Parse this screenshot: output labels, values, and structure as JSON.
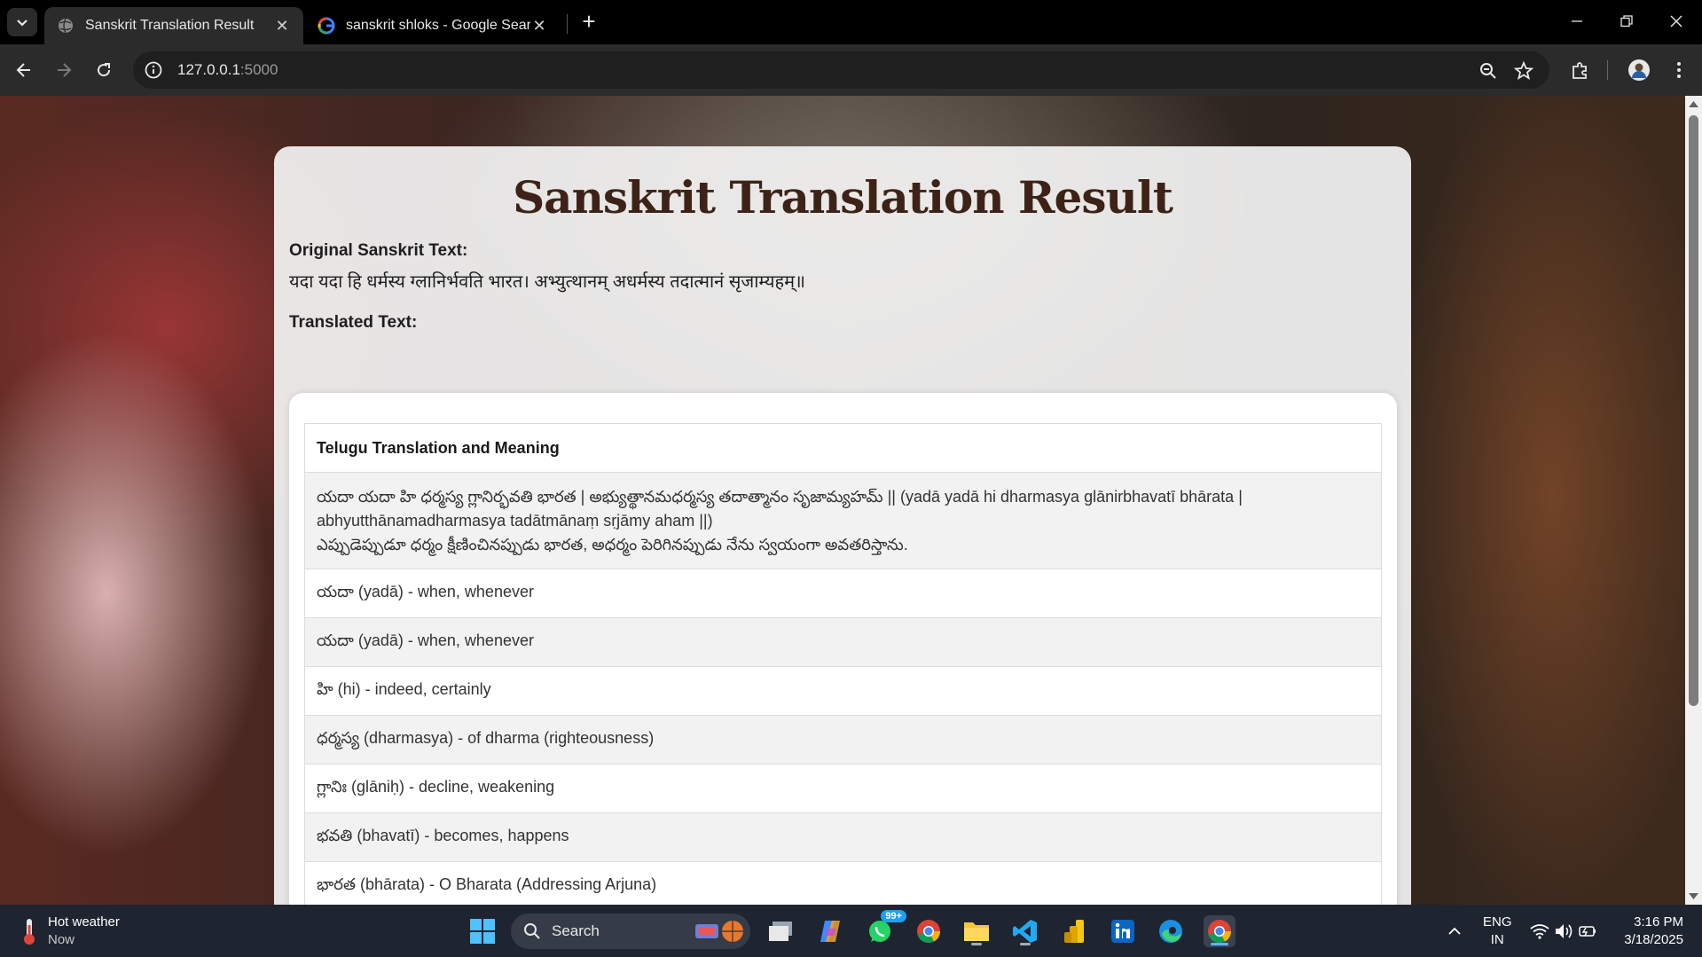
{
  "browser": {
    "tabs": [
      {
        "title": "Sanskrit Translation Result",
        "active": true
      },
      {
        "title": "sanskrit shloks - Google Search",
        "active": false
      }
    ],
    "url_host": "127.0.0.1",
    "url_port": ":5000"
  },
  "page": {
    "title": "Sanskrit Translation Result",
    "original_label": "Original Sanskrit Text:",
    "original_text": "यदा यदा हि धर्मस्य ग्लानिर्भवति भारत। अभ्युत्थानम् अधर्मस्य तदात्मानं सृजाम्यहम्॥",
    "translated_label": "Translated Text:",
    "table_header": "Telugu Translation and Meaning",
    "first_row": {
      "line1": "యదా యదా హి ధర్మస్య గ్లానిర్భవతి భారత | అభ్యుత్థానమధర్మస్య తదాత్మానం సృజామ్యహమ్ || (yadā yadā hi dharmasya glānirbhavatī bhārata |",
      "line2": "abhyutthānamadharmasya tadātmānaṃ sṛjāmy aham ||)",
      "line3": "ఎప్పుడెప్పుడూ ధర్మం క్షీణించినప్పుడు భారత, అధర్మం పెరిగినప్పుడు నేను స్వయంగా అవతరిస్తాను."
    },
    "rows": [
      "యదా (yadā) - when, whenever",
      "యదా (yadā) - when, whenever",
      "హి (hi) - indeed, certainly",
      "ధర్మస్య (dharmasya) - of dharma (righteousness)",
      "గ్లానిః (glāniḥ) - decline, weakening",
      "భవతి (bhavatī) - becomes, happens",
      "భారత (bhārata) - O Bharata (Addressing Arjuna)"
    ]
  },
  "taskbar": {
    "weather_title": "Hot weather",
    "weather_sub": "Now",
    "search_label": "Search",
    "whatsapp_badge": "99+",
    "lang_top": "ENG",
    "lang_bottom": "IN",
    "time": "3:16 PM",
    "date": "3/18/2025"
  }
}
